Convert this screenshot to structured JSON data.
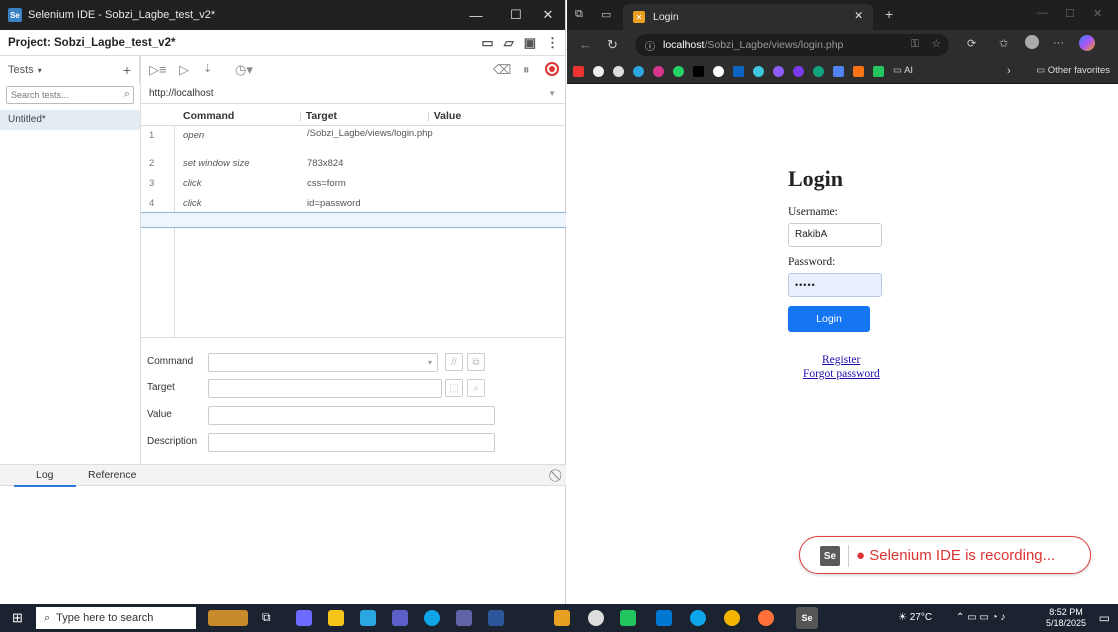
{
  "selenium": {
    "title": "Selenium IDE - Sobzi_Lagbe_test_v2*",
    "logo": "Se",
    "project_label": "Project: Sobzi_Lagbe_test_v2*",
    "tests_dropdown": "Tests",
    "search_placeholder": "Search tests...",
    "test_item": "Untitled*",
    "base_url": "http://localhost",
    "table": {
      "headers": [
        "Command",
        "Target",
        "Value"
      ],
      "rows": [
        {
          "num": "1",
          "command": "open",
          "target": "/Sobzi_Lagbe/views/login.php",
          "value": ""
        },
        {
          "num": "2",
          "command": "set window size",
          "target": "783x824",
          "value": ""
        },
        {
          "num": "3",
          "command": "click",
          "target": "css=form",
          "value": ""
        },
        {
          "num": "4",
          "command": "click",
          "target": "id=password",
          "value": ""
        }
      ]
    },
    "editor": {
      "command_label": "Command",
      "target_label": "Target",
      "value_label": "Value",
      "description_label": "Description"
    },
    "log_tab": "Log",
    "reference_tab": "Reference"
  },
  "browser": {
    "tab_title": "Login",
    "url_host": "localhost",
    "url_path": "/Sobzi_Lagbe/views/login.php",
    "bookmarks_folder_ai": "AI",
    "other_favorites": "Other favorites",
    "page": {
      "heading": "Login",
      "username_label": "Username:",
      "username_value": "RakibA",
      "password_label": "Password:",
      "password_value": "•••••",
      "login_button": "Login",
      "register_link": "Register",
      "forgot_link": "Forgot password"
    },
    "recording_logo": "Se",
    "recording_banner": "● Selenium IDE is recording..."
  },
  "taskbar": {
    "search_placeholder": "Type here to search",
    "weather": "27°C",
    "time": "8:52 PM",
    "date": "5/18/2025",
    "selenium_app_label": "Se"
  },
  "colors": {
    "accent_blue": "#1476f2",
    "record_red": "#d33333",
    "dark_chrome": "#2d2d2d"
  }
}
